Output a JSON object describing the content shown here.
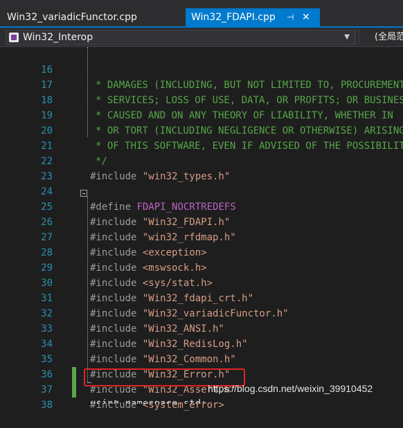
{
  "tabs": [
    {
      "label": "Win32_variadicFunctor.cpp",
      "active": false
    },
    {
      "label": "Win32_FDAPI.cpp",
      "active": true,
      "pin_icon": "⊣",
      "close_icon": "✕"
    }
  ],
  "navbar": {
    "project": "Win32_Interop",
    "scope": "(全局范围)"
  },
  "lines": [
    {
      "num": "16",
      "text": "* DAMAGES (INCLUDING, BUT NOT LIMITED TO, PROCUREMENT OF"
    },
    {
      "num": "17",
      "text": "* SERVICES; LOSS OF USE, DATA, OR PROFITS; OR BUSINESS"
    },
    {
      "num": "18",
      "text": "* CAUSED AND ON ANY THEORY OF LIABILITY, WHETHER IN"
    },
    {
      "num": "19",
      "text": "* OR TORT (INCLUDING NEGLIGENCE OR OTHERWISE) ARISING"
    },
    {
      "num": "20",
      "text": "* OF THIS SOFTWARE, EVEN IF ADVISED OF THE POSSIBILITY"
    },
    {
      "num": "21",
      "text": "*/"
    },
    {
      "num": "22",
      "kw": "#include ",
      "arg": "\"win32_types.h\""
    },
    {
      "num": "23"
    },
    {
      "num": "24",
      "kw": "#define ",
      "arg": "FDAPI_NOCRTREDEFS"
    },
    {
      "num": "25",
      "kw": "#include ",
      "arg": "\"Win32_FDAPI.h\""
    },
    {
      "num": "26",
      "kw": "#include ",
      "arg": "\"win32_rfdmap.h\""
    },
    {
      "num": "27",
      "kw": "#include ",
      "arg": "<exception>"
    },
    {
      "num": "28",
      "kw": "#include ",
      "arg": "<mswsock.h>"
    },
    {
      "num": "29",
      "kw": "#include ",
      "arg": "<sys/stat.h>"
    },
    {
      "num": "30",
      "kw": "#include ",
      "arg": "\"Win32_fdapi_crt.h\""
    },
    {
      "num": "31",
      "kw": "#include ",
      "arg": "\"Win32_variadicFunctor.h\""
    },
    {
      "num": "32",
      "kw": "#include ",
      "arg": "\"Win32_ANSI.h\""
    },
    {
      "num": "33",
      "kw": "#include ",
      "arg": "\"Win32_RedisLog.h\""
    },
    {
      "num": "34",
      "kw": "#include ",
      "arg": "\"Win32_Common.h\""
    },
    {
      "num": "35",
      "kw": "#include ",
      "arg": "\"Win32_Error.h\""
    },
    {
      "num": "36",
      "kw": "#include ",
      "arg": "\"Win32_Assert.h\""
    },
    {
      "num": "37",
      "kw": "#include ",
      "arg": "<system_error>"
    },
    {
      "num": "38"
    }
  ],
  "partial_line": "using namespace std;",
  "watermark": "https://blog.csdn.net/weixin_39910452",
  "colors": {
    "line_number": "#2b91af",
    "comment": "#57a64a",
    "string": "#d69d85",
    "macro": "#bd63c5",
    "highlight_box": "#e02424",
    "active_tab": "#007acc"
  }
}
